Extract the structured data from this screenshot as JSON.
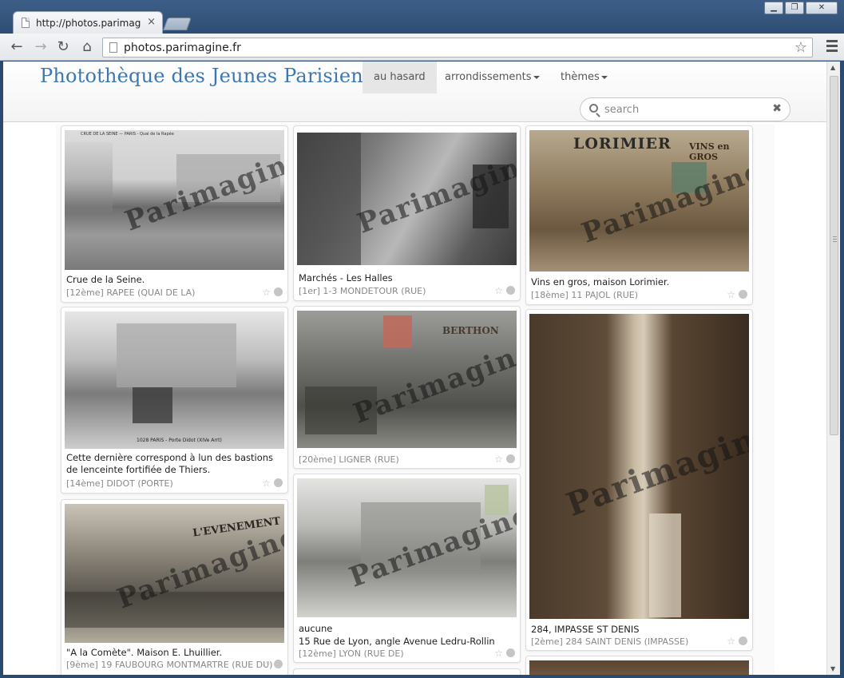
{
  "browser": {
    "tab_title": "http://photos.parimagine.fr",
    "tab_close": "×",
    "url": "photos.parimagine.fr",
    "window_buttons": [
      "▁",
      "❐",
      "✕"
    ]
  },
  "site": {
    "title": "Photothèque des Jeunes Parisiens",
    "nav": {
      "random": "au hasard",
      "arrondissements": "arrondissements",
      "themes": "thèmes"
    },
    "search_placeholder": "search",
    "clear_icon": "✖"
  },
  "watermark": "Parimagine",
  "cards": [
    {
      "caption": "Crue de la Seine.",
      "location": "[12ème] RAPEE (QUAI DE LA)",
      "photo_text": "CRUE DE LA SEINE — PARIS - Quai de la Rapée"
    },
    {
      "caption": "Marchés - Les Halles",
      "location": "[1er] 1-3 MONDETOUR (RUE)"
    },
    {
      "caption": "Vins en gros, maison Lorimier.",
      "location": "[18ème] 11 PAJOL (RUE)",
      "photo_text": "LORIMIER",
      "photo_text2": "VINS en GROS"
    },
    {
      "caption": "Cette dernière correspond à lun des bastions de lenceinte fortifiée de Thiers.",
      "location": "[14ème] DIDOT (PORTE)",
      "photo_text": "1028 PARIS - Porte Didot (XIVe Arrt)"
    },
    {
      "caption": "",
      "location": "[20ème] LIGNER (RUE)",
      "photo_text": "BERTHON"
    },
    {
      "caption": "284, IMPASSE ST DENIS",
      "location": "[2ème] 284 SAINT DENIS (IMPASSE)"
    },
    {
      "caption": "\"A la Comète\". Maison E. Lhuillier.",
      "location": "[9ème] 19 FAUBOURG MONTMARTRE (RUE DU)",
      "photo_text": "L'EVENEMENT"
    },
    {
      "caption_line1": "aucune",
      "caption_line2": "15 Rue de Lyon, angle Avenue Ledru-Rollin",
      "location": "[12ème] LYON (RUE DE)"
    }
  ],
  "actions": {
    "star": "☆"
  }
}
